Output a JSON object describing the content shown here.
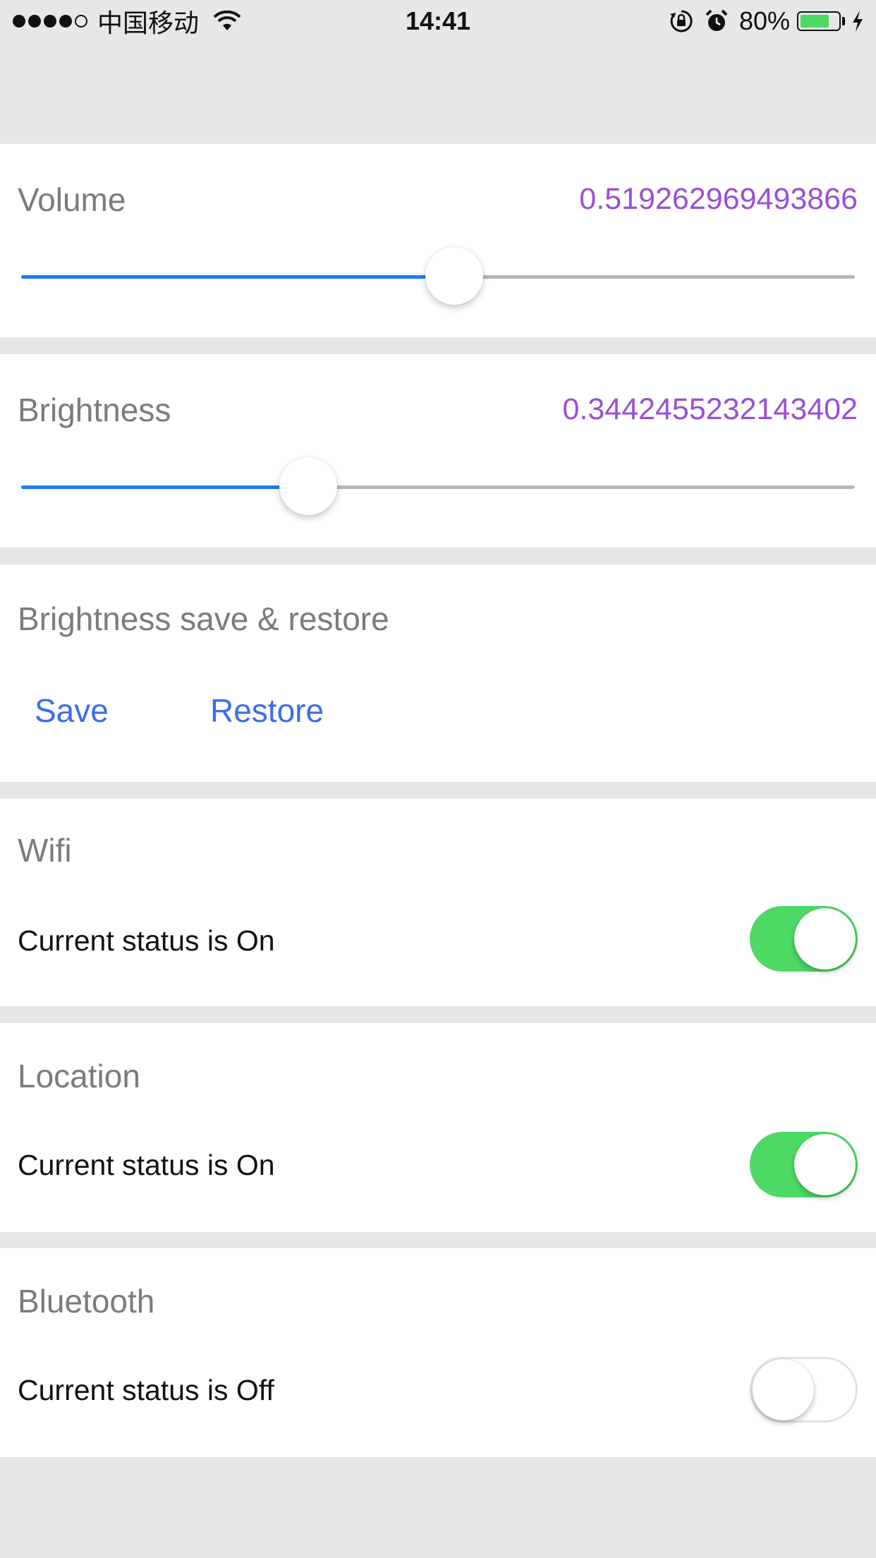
{
  "status_bar": {
    "carrier": "中国移动",
    "time": "14:41",
    "battery": "80%",
    "battery_level": 0.8,
    "icons": [
      "signal-dots-icon",
      "wifi-icon",
      "rotation-lock-icon",
      "alarm-icon",
      "battery-icon",
      "charging-bolt-icon"
    ]
  },
  "volume": {
    "title": "Volume",
    "value": "0.519262969493866",
    "level": 0.519262969493866
  },
  "brightness": {
    "title": "Brightness",
    "value": "0.3442455232143402",
    "level": 0.3442455232143402
  },
  "brightness_save": {
    "title": "Brightness save & restore",
    "save_label": "Save",
    "restore_label": "Restore"
  },
  "wifi": {
    "title": "Wifi",
    "status": "Current status is On",
    "on": true
  },
  "location": {
    "title": "Location",
    "status": "Current status is On",
    "on": true
  },
  "bluetooth": {
    "title": "Bluetooth",
    "status": "Current status is Off",
    "on": false
  },
  "colors": {
    "accent_value": "#9a4fd6",
    "slider_fill": "#1a7cf5",
    "link": "#3a6df0",
    "toggle_on": "#4cd964",
    "background": "#e6e7e9"
  }
}
